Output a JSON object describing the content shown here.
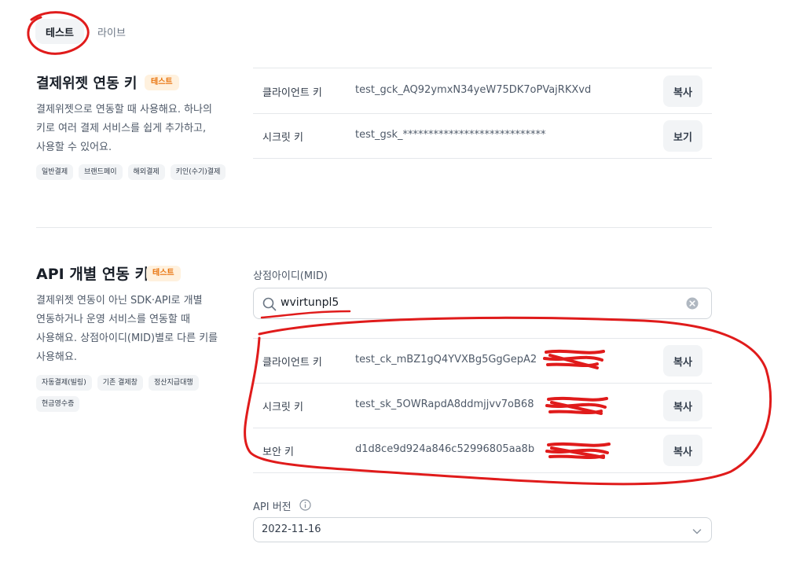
{
  "tabs": {
    "test": "테스트",
    "live": "라이브"
  },
  "widget": {
    "title": "결제위젯 연동 키",
    "badge": "테스트",
    "description": "결제위젯으로 연동할 때 사용해요. 하나의\n키로 여러 결제 서비스를 쉽게 추가하고,\n사용할 수 있어요.",
    "chips": [
      "일반결제",
      "브랜드페이",
      "해외결제",
      "키인(수기)결제"
    ],
    "rows": [
      {
        "label": "클라이언트 키",
        "value": "test_gck_AQ92ymxN34yeW75DK7oPVajRKXvd",
        "button": "복사"
      },
      {
        "label": "시크릿 키",
        "value": "test_gsk_****************************",
        "button": "보기"
      }
    ]
  },
  "api": {
    "title": "API 개별 연동 키",
    "badge": "테스트",
    "description": "결제위젯 연동이 아닌 SDK·API로 개별\n연동하거나 운영 서비스를 연동할 때\n사용해요. 상점아이디(MID)별로 다른 키를\n사용해요.",
    "chips": [
      "자동결제(빌링)",
      "기존 결제창",
      "정산지급대행",
      "현금영수증"
    ],
    "mid_label": "상점아이디(MID)",
    "mid_value": "wvirtunpl5",
    "rows": [
      {
        "label": "클라이언트 키",
        "value": "test_ck_mBZ1gQ4YVXBg5GgGepA2",
        "button": "복사"
      },
      {
        "label": "시크릿 키",
        "value": "test_sk_5OWRapdA8ddmjjvv7oB68",
        "button": "복사"
      },
      {
        "label": "보안 키",
        "value": "d1d8ce9d924a846c52996805aa8b",
        "button": "복사"
      }
    ],
    "version_label": "API 버전",
    "version_value": "2022-11-16"
  },
  "colors": {
    "badge_bg": "#fff1de",
    "badge_text": "#e8730c",
    "annotation": "#e01b1b"
  },
  "icons": [
    "search-icon",
    "clear-icon",
    "info-icon",
    "chevron-down-icon"
  ]
}
